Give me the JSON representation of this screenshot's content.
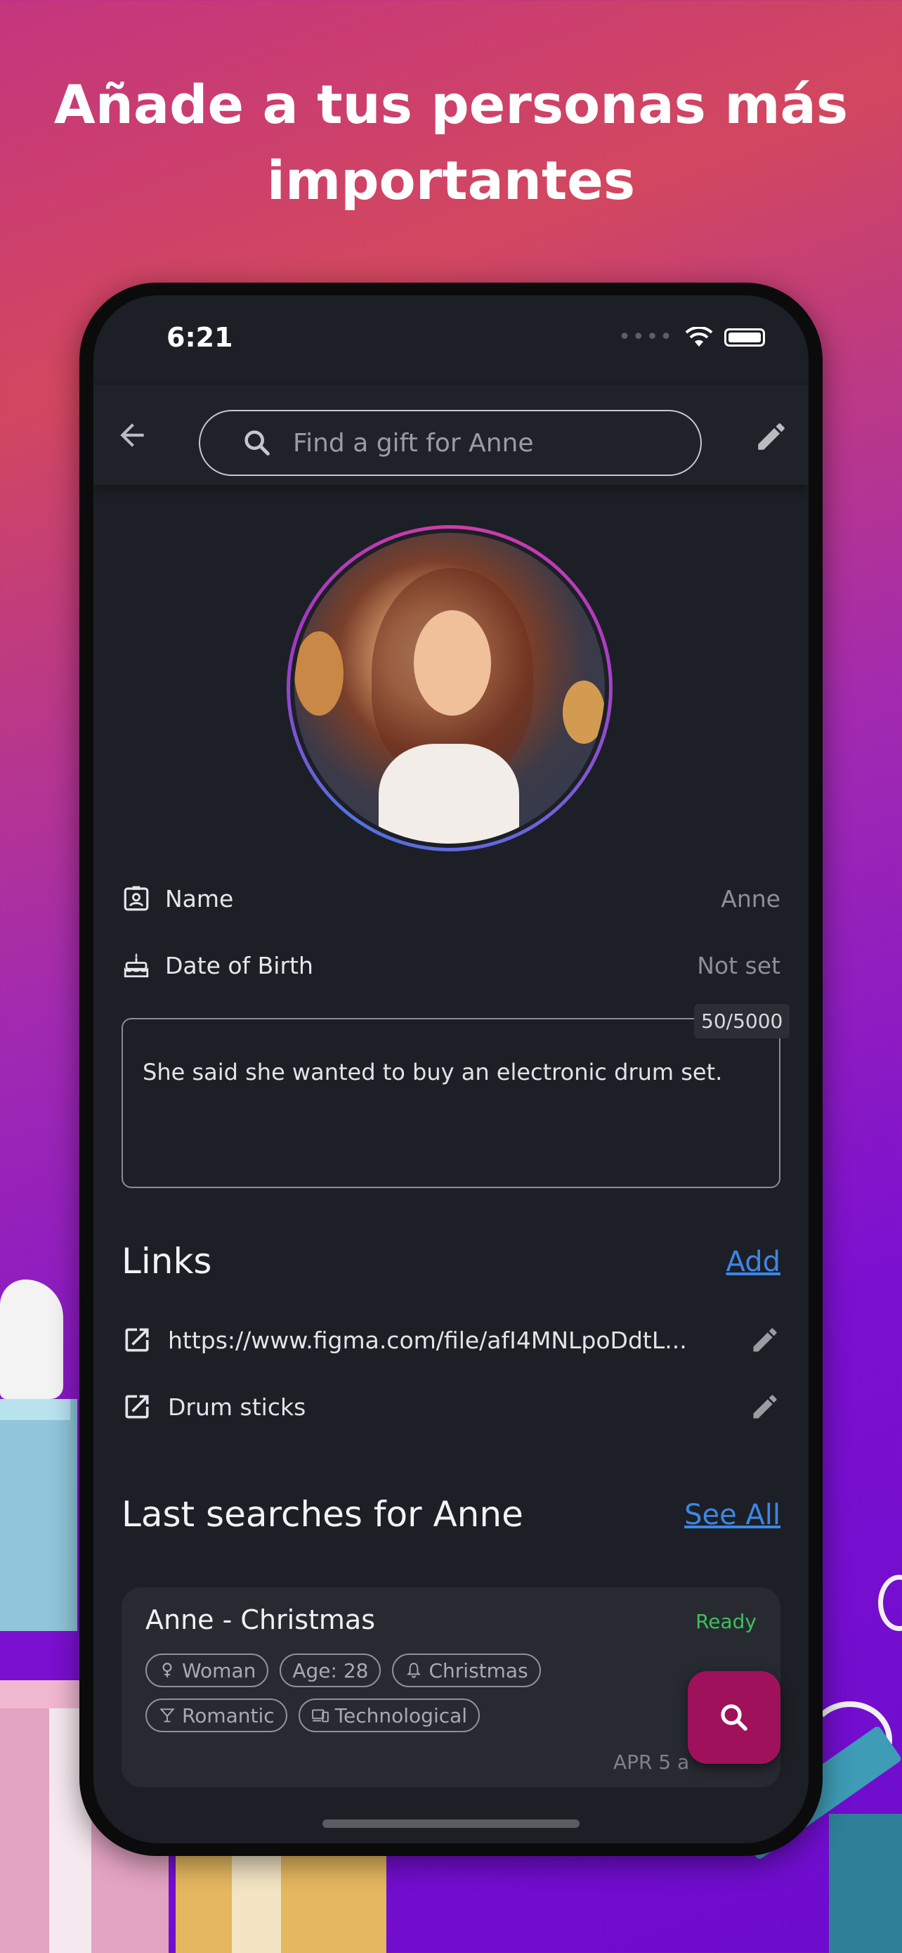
{
  "headline": {
    "line1": "Añade a tus personas más",
    "line2": "importantes"
  },
  "status_bar": {
    "time": "6:21"
  },
  "header": {
    "search_placeholder": "Find a gift for Anne"
  },
  "profile": {
    "name_label": "Name",
    "name_value": "Anne",
    "dob_label": "Date of Birth",
    "dob_value": "Not set",
    "notes": "She said she wanted to buy an electronic drum set.",
    "notes_counter": "50/5000"
  },
  "links": {
    "title": "Links",
    "add_label": "Add",
    "items": [
      {
        "label": "https://www.figma.com/file/afI4MNLpoDdtL..."
      },
      {
        "label": "Drum sticks"
      }
    ]
  },
  "searches": {
    "title": "Last searches for Anne",
    "see_all_label": "See All",
    "card": {
      "title": "Anne - Christmas",
      "status": "Ready",
      "tags": [
        "Woman",
        "Age: 28",
        "Christmas",
        "Romantic",
        "Technological"
      ],
      "date": "APR 5 a"
    }
  },
  "colors": {
    "accent_link": "#3d86e6",
    "status_ready": "#3fbf5f",
    "fab": "#a0115c",
    "screen_bg": "#1c1f25"
  }
}
